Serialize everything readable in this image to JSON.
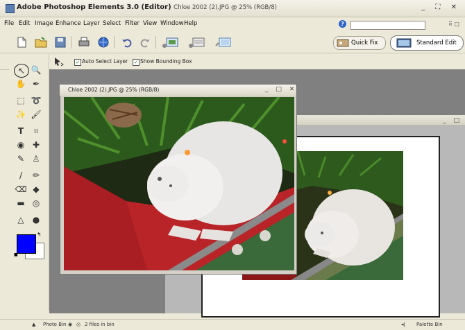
{
  "window": {
    "app_name": "Adobe Photoshop Elements 3.0 (Editor)",
    "document_name": "Chloe 2002 (2).JPG @ 25% (RGB/8)",
    "controls": "_ ⛶ ✕"
  },
  "menubar": {
    "items": [
      "File",
      "Edit",
      "Image",
      "Enhance",
      "Layer",
      "Select",
      "Filter",
      "View",
      "Window",
      "Help"
    ],
    "search_value": ""
  },
  "toolbar": {
    "quick_fix_label": "Quick Fix",
    "standard_edit_label": "Standard Edit"
  },
  "options": {
    "auto_select_label": "Auto Select Layer",
    "auto_select_checked": true,
    "bounding_box_label": "Show Bounding Box",
    "bounding_box_checked": true
  },
  "document_front": {
    "title": "Chloe 2002 (2).JPG @ 25% (RGB/8)",
    "controls": "_ □ ✕"
  },
  "document_back": {
    "controls": "_ □"
  },
  "colors": {
    "foreground": "#0000ff",
    "background": "#ffffff"
  },
  "statusbar": {
    "photo_bin_label": "Photo Bin",
    "files_label": "2 files in bin",
    "palette_bin_label": "Palette Bin"
  }
}
